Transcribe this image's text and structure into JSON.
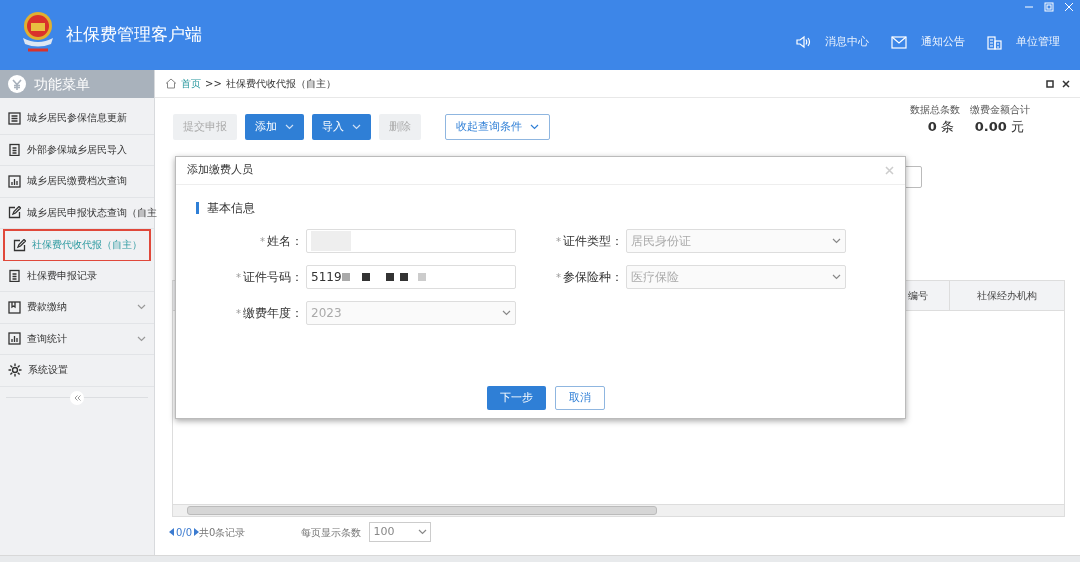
{
  "window": {
    "title": "社保费管理客户端"
  },
  "header_links": [
    {
      "kind": "speaker",
      "label": "消息中心"
    },
    {
      "kind": "mail",
      "label": "通知公告"
    },
    {
      "kind": "building",
      "label": "单位管理"
    }
  ],
  "sidebar": {
    "title": "功能菜单",
    "items": [
      {
        "kind": "list",
        "label": "城乡居民参保信息更新",
        "selected": false,
        "expandable": false
      },
      {
        "kind": "clipboard",
        "label": "外部参保城乡居民导入",
        "selected": false,
        "expandable": false
      },
      {
        "kind": "chart",
        "label": "城乡居民缴费档次查询",
        "selected": false,
        "expandable": false
      },
      {
        "kind": "edit",
        "label": "城乡居民申报状态查询（自主",
        "selected": false,
        "expandable": false
      },
      {
        "kind": "edit",
        "label": "社保费代收代报（自主）",
        "selected": true,
        "expandable": false
      },
      {
        "kind": "clipboard",
        "label": "社保费申报记录",
        "selected": false,
        "expandable": false
      },
      {
        "kind": "book",
        "label": "费款缴纳",
        "selected": false,
        "expandable": true
      },
      {
        "kind": "chart",
        "label": "查询统计",
        "selected": false,
        "expandable": true
      },
      {
        "kind": "gear",
        "label": "系统设置",
        "selected": false,
        "expandable": false
      }
    ]
  },
  "breadcrumb": {
    "home": "首页",
    "separator": ">>",
    "current": "社保费代收代报（自主）"
  },
  "toolbar": [
    {
      "kind": "disabled",
      "label": "提交申报",
      "dropdown": false
    },
    {
      "kind": "primary",
      "label": "添加",
      "dropdown": true
    },
    {
      "kind": "primary",
      "label": "导入",
      "dropdown": true
    },
    {
      "kind": "disabled",
      "label": "删除",
      "dropdown": false
    },
    {
      "kind": "outline",
      "label": "收起查询条件",
      "dropdown": true
    }
  ],
  "stats": [
    {
      "label": "数据总条数",
      "value": "0",
      "unit": "条"
    },
    {
      "label": "缴费金额合计",
      "value": "0.00",
      "unit": "元"
    }
  ],
  "table": {
    "columns": [
      "编号",
      "社保经办机构"
    ]
  },
  "pagination": {
    "pages": "0/0",
    "total": "共0条记录",
    "page_size_label": "每页显示条数",
    "page_size": "100"
  },
  "dialog": {
    "title": "添加缴费人员",
    "section": "基本信息",
    "fields": [
      {
        "required_mark": "*",
        "label": "姓名：",
        "kind": "text",
        "redacted": true
      },
      {
        "required_mark": "*",
        "label": "证件类型：",
        "kind": "select",
        "value": "居民身份证"
      },
      {
        "required_mark": "*",
        "label": "证件号码：",
        "kind": "text",
        "value": "5119",
        "redacted": true
      },
      {
        "required_mark": "*",
        "label": "参保险种：",
        "kind": "select",
        "value": "医疗保险"
      },
      {
        "required_mark": "*",
        "label": "缴费年度：",
        "kind": "select",
        "value": "2023"
      }
    ],
    "buttons": [
      {
        "kind": "primary",
        "label": "下一步"
      },
      {
        "kind": "outline",
        "label": "取消"
      }
    ]
  }
}
